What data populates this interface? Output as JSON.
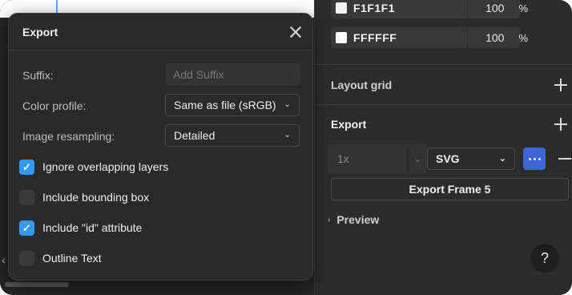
{
  "dialog": {
    "title": "Export",
    "suffix": {
      "label": "Suffix:",
      "placeholder": "Add Suffix"
    },
    "color_profile": {
      "label": "Color profile:",
      "value": "Same as file (sRGB)"
    },
    "image_resampling": {
      "label": "Image resampling:",
      "value": "Detailed"
    },
    "options": [
      {
        "label": "Ignore overlapping layers",
        "checked": true
      },
      {
        "label": "Include bounding box",
        "checked": false
      },
      {
        "label": "Include \"id\" attribute",
        "checked": true
      },
      {
        "label": "Outline Text",
        "checked": false
      }
    ]
  },
  "right_panel": {
    "fills": [
      {
        "hex": "F1F1F1",
        "opacity": "100",
        "unit": "%",
        "swatch_color": "#f1f1f1"
      },
      {
        "hex": "FFFFFF",
        "opacity": "100",
        "unit": "%",
        "swatch_color": "#ffffff"
      }
    ],
    "layout_grid_title": "Layout grid",
    "export_title": "Export",
    "export_setting": {
      "scale": "1x",
      "format": "SVG"
    },
    "export_button": "Export Frame 5",
    "preview_label": "Preview",
    "help_label": "?"
  },
  "colors": {
    "accent": "#2f9bff",
    "more_button": "#3d66d6",
    "panel_bg": "#2c2c2c",
    "dialog_bg": "#2a2a2a"
  }
}
